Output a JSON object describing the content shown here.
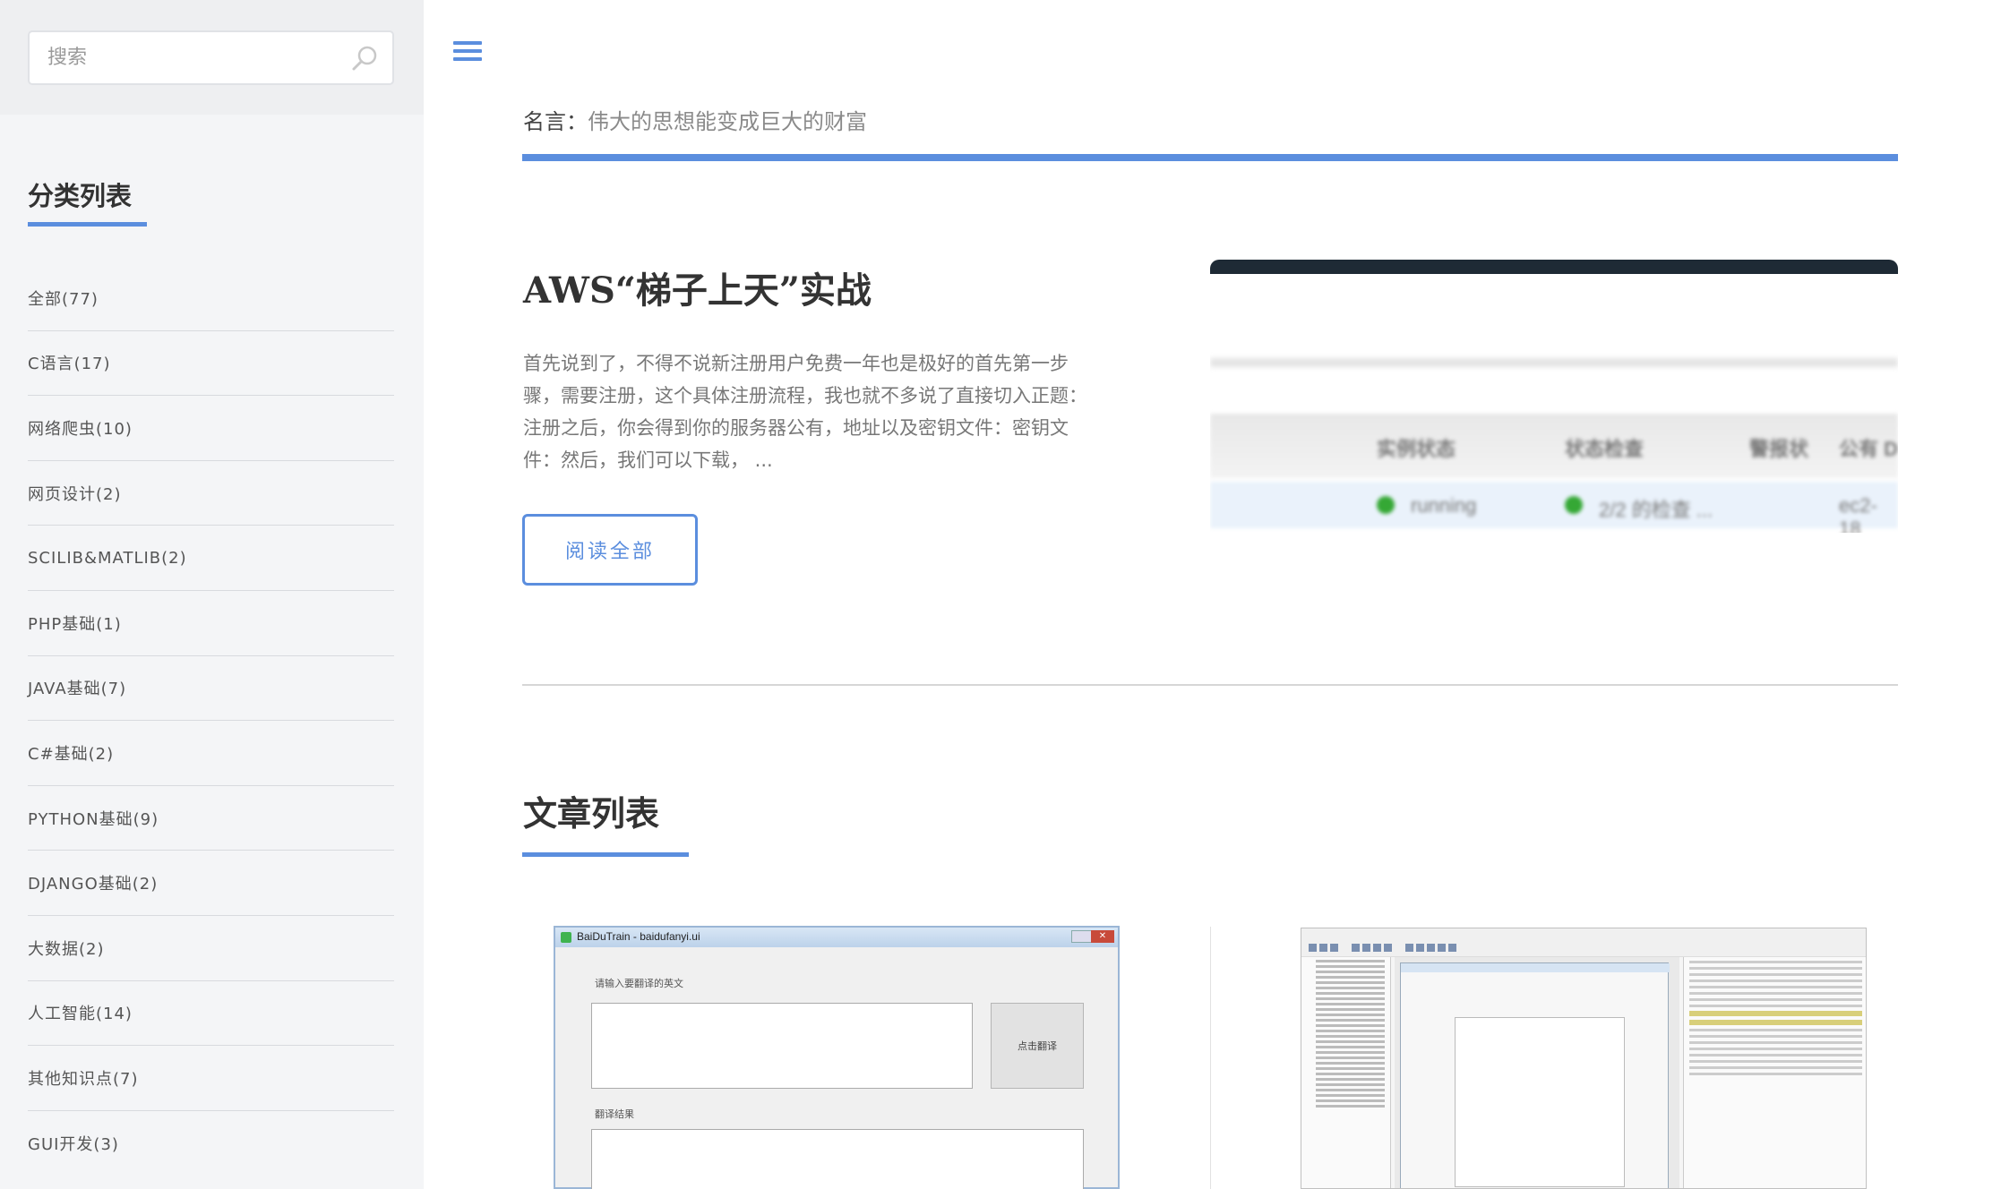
{
  "search": {
    "placeholder": "搜索"
  },
  "sidebar": {
    "title": "分类列表",
    "categories": [
      "全部(77)",
      "C语言(17)",
      "网络爬虫(10)",
      "网页设计(2)",
      "SCILIB&MATLIB(2)",
      "PHP基础(1)",
      "JAVA基础(7)",
      "C#基础(2)",
      "PYTHON基础(9)",
      "DJANGO基础(2)",
      "大数据(2)",
      "人工智能(14)",
      "其他知识点(7)",
      "GUI开发(3)"
    ]
  },
  "header": {
    "quote_label": "名言：",
    "quote_text": "伟大的思想能变成巨大的财富"
  },
  "featured": {
    "title": "AWS“梯子上天”实战",
    "excerpt": "首先说到了，不得不说新注册用户免费一年也是极好的首先第一步骤，需要注册，这个具体注册流程，我也就不多说了直接切入正题：注册之后，你会得到你的服务器公有，地址以及密钥文件：密钥文件：然后，我们可以下载， ...",
    "read_more": "阅读全部"
  },
  "featured_image": {
    "col1": "实例状态",
    "col2": "状态检查",
    "col3": "警报状",
    "col4": "公有 D",
    "row_state": "running",
    "row_check": "2/2 的检查 ...",
    "row_dns": "ec2-18"
  },
  "articles": {
    "title": "文章列表",
    "thumb1": {
      "window_title": "BaiDuTrain - baidufanyi.ui",
      "input_label": "请输入要翻译的英文",
      "button_label": "点击翻译",
      "result_label": "翻译结果"
    }
  },
  "colors": {
    "accent": "#5b8ede",
    "sidebar_bg": "#f4f5f7"
  }
}
